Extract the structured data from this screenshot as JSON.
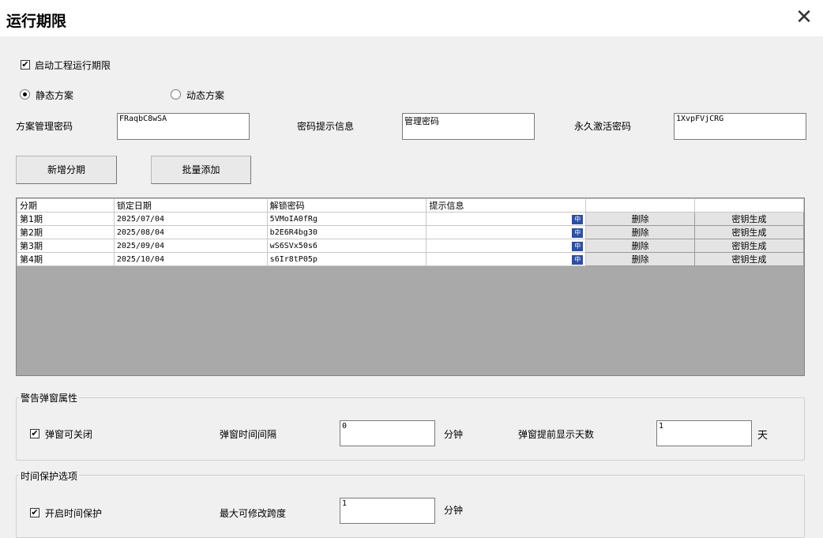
{
  "window": {
    "title": "运行期限",
    "close_glyph": "✕"
  },
  "enable_checkbox": {
    "label": "启动工程运行期限",
    "checked": true
  },
  "scheme": {
    "static_label": "静态方案",
    "dynamic_label": "动态方案",
    "selected": "static"
  },
  "fields": {
    "admin_password_label": "方案管理密码",
    "admin_password_value": "FRaqbC8wSA",
    "hint_label": "密码提示信息",
    "hint_value": "管理密码",
    "permanent_label": "永久激活密码",
    "permanent_value": "1XvpFVjCRG"
  },
  "buttons": {
    "add_period": "新增分期",
    "batch_add": "批量添加"
  },
  "table": {
    "headers": [
      "分期",
      "锁定日期",
      "解锁密码",
      "提示信息",
      "",
      ""
    ],
    "rows": [
      {
        "period": "第1期",
        "date": "2025/07/04",
        "password": "5VMoIA0fRg",
        "hint": "",
        "ime": "中",
        "delete": "删除",
        "keygen": "密钥生成"
      },
      {
        "period": "第2期",
        "date": "2025/08/04",
        "password": "b2E6R4bg30",
        "hint": "",
        "ime": "中",
        "delete": "删除",
        "keygen": "密钥生成"
      },
      {
        "period": "第3期",
        "date": "2025/09/04",
        "password": "wS6SVx50s6",
        "hint": "",
        "ime": "中",
        "delete": "删除",
        "keygen": "密钥生成"
      },
      {
        "period": "第4期",
        "date": "2025/10/04",
        "password": "s6Ir8tP05p",
        "hint": "",
        "ime": "中",
        "delete": "删除",
        "keygen": "密钥生成"
      }
    ]
  },
  "warning_group": {
    "title": "警告弹窗属性",
    "closable_label": "弹窗可关闭",
    "closable_checked": true,
    "interval_label": "弹窗时间间隔",
    "interval_value": "0",
    "interval_unit": "分钟",
    "advance_label": "弹窗提前显示天数",
    "advance_value": "1",
    "advance_unit": "天"
  },
  "time_group": {
    "title": "时间保护选项",
    "protect_label": "开启时间保护",
    "protect_checked": true,
    "span_label": "最大可修改跨度",
    "span_value": "1",
    "span_unit": "分钟"
  },
  "colors": {
    "grid_empty": "#a9a9a9",
    "ime_icon": "#2b4fa8"
  }
}
